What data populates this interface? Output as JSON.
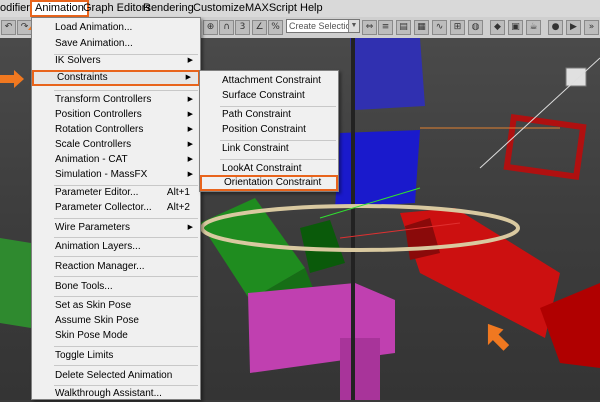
{
  "menubar": {
    "items": [
      "odifiers",
      "Animation",
      "Graph Editors",
      "Rendering",
      "Customize",
      "MAXScript",
      "Help"
    ]
  },
  "toolbar": {
    "selection_set_placeholder": "Create Selection Se"
  },
  "animation_menu": {
    "items": [
      {
        "label": "Load Animation..."
      },
      {
        "label": "Save Animation..."
      },
      {
        "label": "IK Solvers"
      },
      {
        "label": "Constraints"
      },
      {
        "label": "Transform Controllers"
      },
      {
        "label": "Position Controllers"
      },
      {
        "label": "Rotation Controllers"
      },
      {
        "label": "Scale Controllers"
      },
      {
        "label": "Animation - CAT"
      },
      {
        "label": "Simulation - MassFX"
      },
      {
        "label": "Parameter Editor...",
        "shortcut": "Alt+1"
      },
      {
        "label": "Parameter Collector...",
        "shortcut": "Alt+2"
      },
      {
        "label": "Wire Parameters"
      },
      {
        "label": "Animation Layers..."
      },
      {
        "label": "Reaction Manager..."
      },
      {
        "label": "Bone Tools..."
      },
      {
        "label": "Set as Skin Pose"
      },
      {
        "label": "Assume Skin Pose"
      },
      {
        "label": "Skin Pose Mode"
      },
      {
        "label": "Toggle Limits"
      },
      {
        "label": "Delete Selected Animation"
      },
      {
        "label": "Walkthrough Assistant..."
      }
    ]
  },
  "constraints_submenu": {
    "items": [
      {
        "label": "Attachment Constraint"
      },
      {
        "label": "Surface Constraint"
      },
      {
        "label": "Path Constraint"
      },
      {
        "label": "Position Constraint"
      },
      {
        "label": "Link Constraint"
      },
      {
        "label": "LookAt Constraint"
      },
      {
        "label": "Orientation Constraint"
      }
    ]
  },
  "colors": {
    "highlight": "#e8641c",
    "annotation_arrow": "#f07820"
  }
}
